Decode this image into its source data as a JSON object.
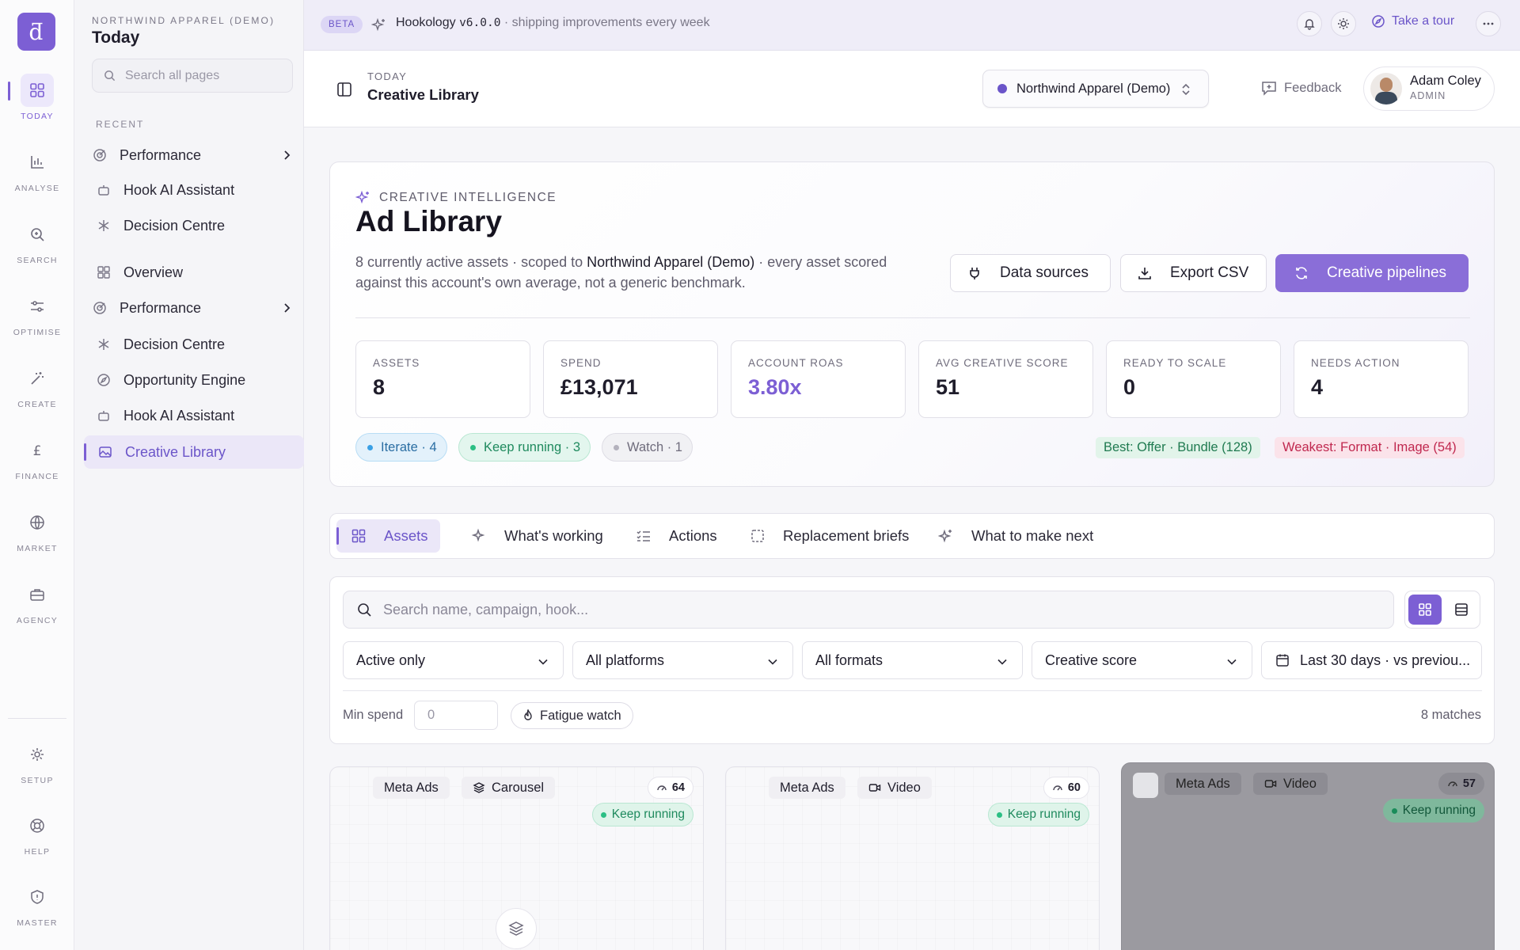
{
  "rail": {
    "items": [
      {
        "label": "TODAY",
        "icon": "grid-icon",
        "active": true
      },
      {
        "label": "ANALYSE",
        "icon": "bar-chart-icon"
      },
      {
        "label": "SEARCH",
        "icon": "search-icon"
      },
      {
        "label": "OPTIMISE",
        "icon": "sliders-icon"
      },
      {
        "label": "CREATE",
        "icon": "magic-wand-icon"
      },
      {
        "label": "FINANCE",
        "icon": "pound-icon"
      },
      {
        "label": "MARKET",
        "icon": "globe-icon"
      },
      {
        "label": "AGENCY",
        "icon": "briefcase-icon"
      },
      {
        "label": "SETUP",
        "icon": "gear-icon"
      },
      {
        "label": "HELP",
        "icon": "lifebuoy-icon"
      },
      {
        "label": "MASTER",
        "icon": "shield-icon"
      }
    ]
  },
  "sidebar": {
    "org": "NORTHWIND APPAREL (DEMO)",
    "title": "Today",
    "search_placeholder": "Search all pages",
    "recent_label": "RECENT",
    "recent": [
      {
        "label": "Performance",
        "icon": "target-icon",
        "has_children": true
      },
      {
        "label": "Hook AI Assistant",
        "icon": "bot-icon"
      },
      {
        "label": "Decision Centre",
        "icon": "asterisk-icon"
      }
    ],
    "items": [
      {
        "label": "Overview",
        "icon": "grid-icon"
      },
      {
        "label": "Performance",
        "icon": "target-icon",
        "has_children": true
      },
      {
        "label": "Decision Centre",
        "icon": "asterisk-icon"
      },
      {
        "label": "Opportunity Engine",
        "icon": "compass-icon"
      },
      {
        "label": "Hook AI Assistant",
        "icon": "bot-icon"
      },
      {
        "label": "Creative Library",
        "icon": "image-icon",
        "selected": true
      }
    ]
  },
  "banner": {
    "badge": "BETA",
    "product": "Hookology",
    "version": "v6.0.0",
    "tagline": "· shipping improvements every week",
    "tour_label": "Take a tour"
  },
  "header": {
    "small": "TODAY",
    "title": "Creative Library",
    "org_selector": "Northwind Apparel (Demo)",
    "feedback_label": "Feedback",
    "user": {
      "name": "Adam Coley",
      "role": "ADMIN"
    }
  },
  "summary": {
    "eyebrow": "CREATIVE INTELLIGENCE",
    "title": "Ad Library",
    "desc_pre": "8 currently active assets · scoped to ",
    "desc_org": "Northwind Apparel (Demo)",
    "desc_post": " · every asset scored against this account's own average, not a generic benchmark.",
    "buttons": {
      "data_sources": "Data sources",
      "export": "Export CSV",
      "pipelines": "Creative pipelines"
    },
    "stats": [
      {
        "label": "ASSETS",
        "value": "8"
      },
      {
        "label": "SPEND",
        "value": "£13,071"
      },
      {
        "label": "ACCOUNT ROAS",
        "value": "3.80x",
        "accent": true
      },
      {
        "label": "AVG CREATIVE SCORE",
        "value": "51"
      },
      {
        "label": "READY TO SCALE",
        "value": "0"
      },
      {
        "label": "NEEDS ACTION",
        "value": "4"
      }
    ],
    "pills": {
      "iterate": "Iterate · 4",
      "keep": "Keep running · 3",
      "watch": "Watch · 1"
    },
    "best": "Best: Offer · Bundle (128)",
    "weakest": "Weakest: Format · Image (54)"
  },
  "tabs": [
    {
      "label": "Assets",
      "icon": "grid-icon",
      "active": true
    },
    {
      "label": "What's working",
      "icon": "sparkle-icon"
    },
    {
      "label": "Actions",
      "icon": "checklist-icon"
    },
    {
      "label": "Replacement briefs",
      "icon": "brief-icon"
    },
    {
      "label": "What to make next",
      "icon": "sparkles-icon"
    }
  ],
  "filters": {
    "search_placeholder": "Search name, campaign, hook...",
    "status": "Active only",
    "platform": "All platforms",
    "format": "All formats",
    "sort": "Creative score",
    "date": "Last 30 days · vs previou...",
    "min_spend_label": "Min spend",
    "min_spend_placeholder": "0",
    "fatigue_label": "Fatigue watch",
    "matches": "8 matches"
  },
  "assets": [
    {
      "platform": "Meta Ads",
      "format": "Carousel",
      "score": "64",
      "status": "Keep running"
    },
    {
      "platform": "Meta Ads",
      "format": "Video",
      "score": "60",
      "status": "Keep running"
    },
    {
      "platform": "Meta Ads",
      "format": "Video",
      "score": "57",
      "status": "Keep running"
    }
  ],
  "colors": {
    "accent": "#7c5fd4",
    "iterate": "#3aa0e5",
    "keep": "#2bbf84",
    "weak": "#c0284f"
  }
}
